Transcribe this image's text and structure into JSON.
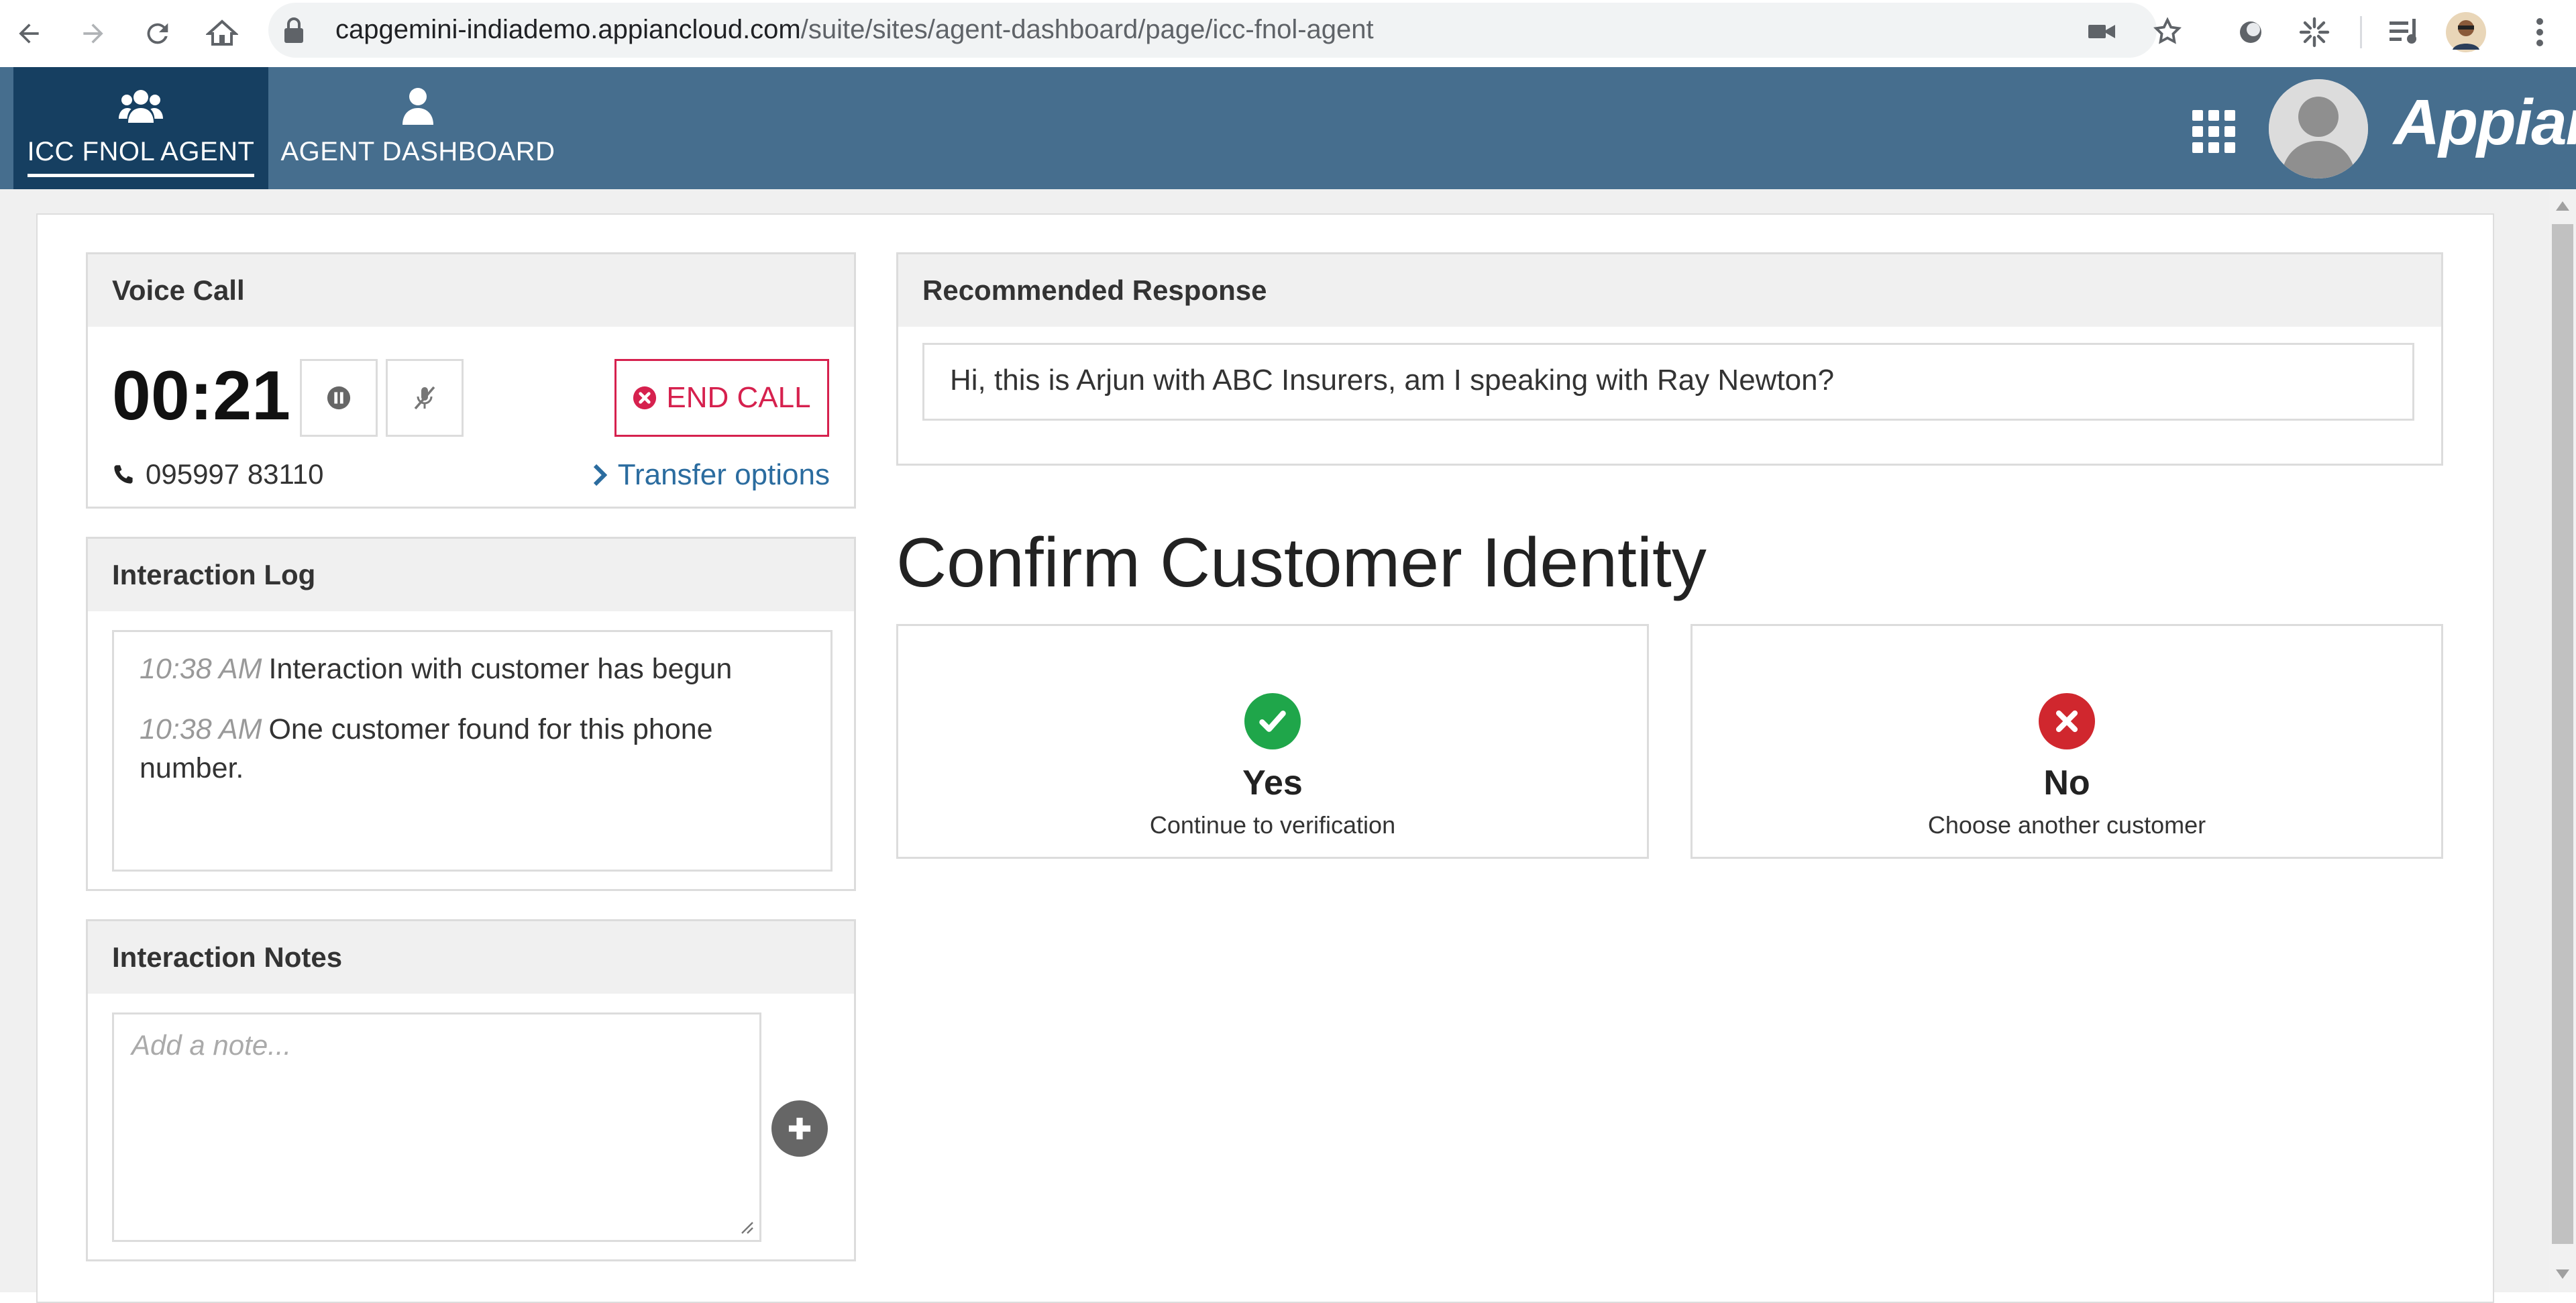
{
  "browser": {
    "url_host": "capgemini-indiademo.appiancloud.com",
    "url_path": "/suite/sites/agent-dashboard/page/icc-fnol-agent"
  },
  "header": {
    "tabs": [
      {
        "label": "ICC FNOL AGENT",
        "icon": "users-group-icon",
        "active": true
      },
      {
        "label": "AGENT DASHBOARD",
        "icon": "user-icon",
        "active": false
      }
    ],
    "brand": "Appian"
  },
  "voice_call": {
    "title": "Voice Call",
    "timer": "00:21",
    "end_call_label": "END CALL",
    "phone_number": "095997 83110",
    "transfer_label": "Transfer options"
  },
  "interaction_log": {
    "title": "Interaction Log",
    "entries": [
      {
        "time": "10:38 AM",
        "text": "Interaction with customer has begun"
      },
      {
        "time": "10:38 AM",
        "text": "One customer found for this phone number."
      }
    ]
  },
  "interaction_notes": {
    "title": "Interaction Notes",
    "placeholder": "Add a note..."
  },
  "recommended_response": {
    "title": "Recommended Response",
    "text": "Hi, this is Arjun with ABC Insurers, am I speaking with Ray Newton?"
  },
  "confirm": {
    "heading": "Confirm Customer Identity",
    "options": [
      {
        "title": "Yes",
        "subtitle": "Continue to verification",
        "icon": "check-circle-icon",
        "color": "#1fa64a"
      },
      {
        "title": "No",
        "subtitle": "Choose another customer",
        "icon": "x-circle-icon",
        "color": "#d0272e"
      }
    ]
  },
  "colors": {
    "header_bg": "#466e8e",
    "active_tab_bg": "#163f61",
    "end_call": "#d6214e",
    "link": "#2b6c9f"
  }
}
